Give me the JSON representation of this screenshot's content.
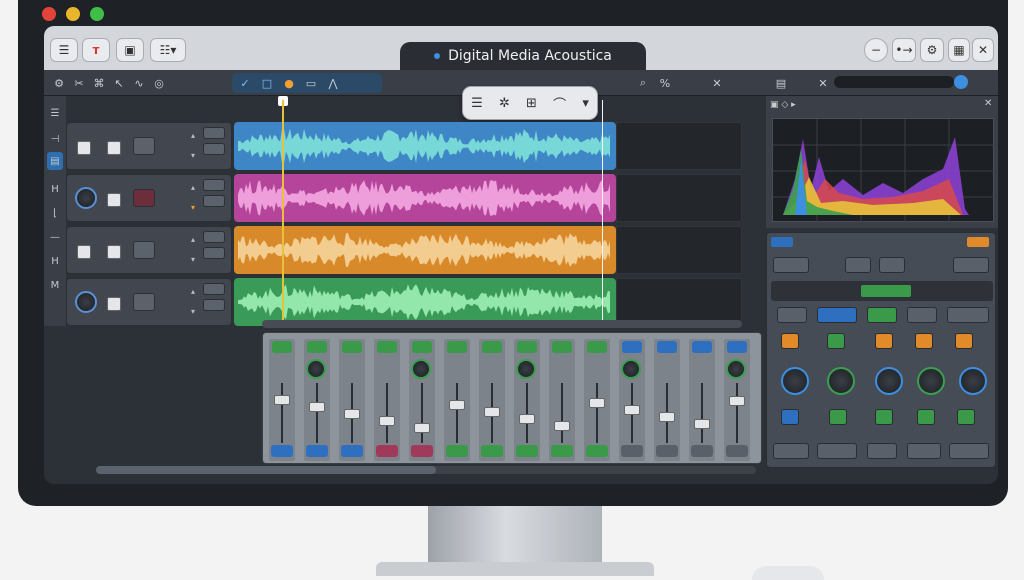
{
  "window": {
    "title": "Digital Media Acoustica"
  },
  "colors": {
    "accent_blue": "#3d8fe0",
    "lane_blue": "#3f86c6",
    "lane_magenta": "#b4459a",
    "lane_orange": "#d88a2a",
    "lane_green": "#3a9a58",
    "wave_blue": "#7ee0d8",
    "wave_magenta": "#f4a7e2",
    "wave_orange": "#f6d49a",
    "wave_green": "#9ef0b4",
    "traffic_red": "#e2443b",
    "traffic_yellow": "#e8b52c",
    "traffic_green": "#3fbf48"
  },
  "icons": {
    "top_left": [
      "menu-icon",
      "logo-icon",
      "image-icon",
      "list-icon"
    ],
    "top_right": [
      "minimize-icon",
      "arrow-icon",
      "gear-icon",
      "grid-icon",
      "close-icon"
    ],
    "floating_toolbar": [
      "menu-icon",
      "gear-icon",
      "grid-icon",
      "curve-icon",
      "chevron-down-icon"
    ],
    "sidebar": [
      "list-icon",
      "tools-icon",
      "panel-icon",
      "h-icon",
      "corner-icon",
      "dash-icon",
      "h-icon",
      "m-icon"
    ]
  },
  "lanes": [
    {
      "name": "track-1",
      "color": "#3f86c6",
      "wave": "#7ee0d8"
    },
    {
      "name": "track-2",
      "color": "#b4459a",
      "wave": "#f4a7e2"
    },
    {
      "name": "track-3",
      "color": "#d88a2a",
      "wave": "#f6d49a"
    },
    {
      "name": "track-4",
      "color": "#3a9a58",
      "wave": "#9ef0b4"
    }
  ],
  "mixer": {
    "strip_count": 14
  }
}
